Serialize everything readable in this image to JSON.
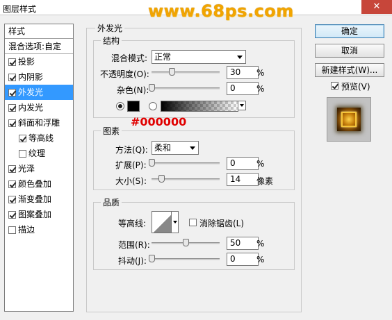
{
  "window": {
    "title": "图层样式",
    "close_glyph": "✕",
    "watermark": "www.68ps.com"
  },
  "styles_panel": {
    "header": "样式",
    "blend_options": "混合选项:自定",
    "items": [
      {
        "label": "投影",
        "checked": true,
        "sub": false,
        "selected": false
      },
      {
        "label": "内阴影",
        "checked": true,
        "sub": false,
        "selected": false
      },
      {
        "label": "外发光",
        "checked": true,
        "sub": false,
        "selected": true
      },
      {
        "label": "内发光",
        "checked": true,
        "sub": false,
        "selected": false
      },
      {
        "label": "斜面和浮雕",
        "checked": true,
        "sub": false,
        "selected": false
      },
      {
        "label": "等高线",
        "checked": true,
        "sub": true,
        "selected": false
      },
      {
        "label": "纹理",
        "checked": false,
        "sub": true,
        "selected": false
      },
      {
        "label": "光泽",
        "checked": true,
        "sub": false,
        "selected": false
      },
      {
        "label": "颜色叠加",
        "checked": true,
        "sub": false,
        "selected": false
      },
      {
        "label": "渐变叠加",
        "checked": true,
        "sub": false,
        "selected": false
      },
      {
        "label": "图案叠加",
        "checked": true,
        "sub": false,
        "selected": false
      },
      {
        "label": "描边",
        "checked": false,
        "sub": false,
        "selected": false
      }
    ]
  },
  "outer_glow": {
    "title": "外发光",
    "structure": {
      "title": "结构",
      "blend_mode_label": "混合模式:",
      "blend_mode_value": "正常",
      "opacity_label": "不透明度(O):",
      "opacity_value": "30",
      "opacity_unit": "%",
      "noise_label": "杂色(N):",
      "noise_value": "0",
      "noise_unit": "%",
      "color_radio_selected": true,
      "gradient_radio_selected": false,
      "color_annotation": "#000000",
      "color_hex": "#000000"
    },
    "elements": {
      "title": "图素",
      "technique_label": "方法(Q):",
      "technique_value": "柔和",
      "spread_label": "扩展(P):",
      "spread_value": "0",
      "spread_unit": "%",
      "size_label": "大小(S):",
      "size_value": "14",
      "size_unit": "像素"
    },
    "quality": {
      "title": "品质",
      "contour_label": "等高线:",
      "anti_alias_label": "消除锯齿(L)",
      "anti_alias_checked": false,
      "range_label": "范围(R):",
      "range_value": "50",
      "range_unit": "%",
      "jitter_label": "抖动(J):",
      "jitter_value": "0",
      "jitter_unit": "%"
    }
  },
  "buttons": {
    "ok": "确定",
    "cancel": "取消",
    "new_style": "新建样式(W)...",
    "preview_label": "预览(V)",
    "preview_checked": true
  },
  "colors": {
    "selection": "#3399ff",
    "annotation": "#e00000",
    "watermark": "#f2a500"
  }
}
